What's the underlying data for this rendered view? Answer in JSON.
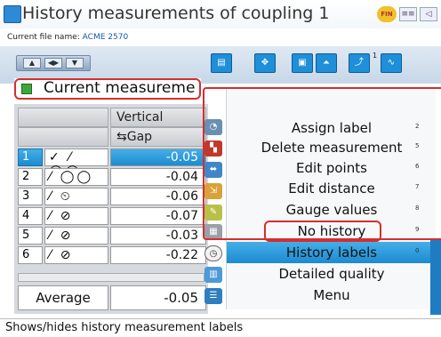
{
  "window": {
    "title": "History measurements of coupling 1",
    "status_badge": "FIN",
    "mini_icons": [
      "≡≡",
      "◁"
    ]
  },
  "file": {
    "label": "Current file name:",
    "name": "ACME 2570"
  },
  "toolbar": {
    "nav_buttons": [
      "▲",
      "◀▶",
      "▼"
    ],
    "icons": [
      {
        "name": "grid-icon",
        "glyph": "▤"
      },
      {
        "name": "compass-icon",
        "glyph": "✥"
      },
      {
        "name": "monitor-icon",
        "glyph": "▣"
      },
      {
        "name": "wave-icon",
        "glyph": "⏶"
      },
      {
        "name": "chart-icon",
        "glyph": "⤴"
      },
      {
        "name": "trend-icon",
        "glyph": "∿"
      }
    ],
    "superscript": "1"
  },
  "measurement_header": "Current measureme",
  "table": {
    "column_header": "Vertical",
    "sub_header": "Gap",
    "rows": [
      {
        "num": "1",
        "icons": "✓ ⁄ ◯◯",
        "value": "-0.05",
        "selected": true
      },
      {
        "num": "2",
        "icons": "⁄ ◯◯",
        "value": "-0.04",
        "selected": false
      },
      {
        "num": "3",
        "icons": "⁄ ⏲",
        "value": "-0.06",
        "selected": false
      },
      {
        "num": "4",
        "icons": "⁄ ⊘",
        "value": "-0.07",
        "selected": false
      },
      {
        "num": "5",
        "icons": "⁄ ⊘",
        "value": "-0.03",
        "selected": false
      },
      {
        "num": "6",
        "icons": "⁄ ⊘",
        "value": "-0.22",
        "selected": false
      }
    ],
    "average_label": "Average",
    "average_value": "-0.05"
  },
  "menu": {
    "items": [
      {
        "label": "Assign label",
        "key": "2"
      },
      {
        "label": "Delete measurement",
        "key": "5"
      },
      {
        "label": "Edit points",
        "key": "6"
      },
      {
        "label": "Edit distance",
        "key": "7"
      },
      {
        "label": "Gauge values",
        "key": "8"
      },
      {
        "label": "No history",
        "key": "9"
      },
      {
        "label": "History labels",
        "key": "0"
      },
      {
        "label": "Detailed quality",
        "key": ""
      },
      {
        "label": "Menu",
        "key": ""
      }
    ],
    "active_index": 6
  },
  "status": "Shows/hides history measurement labels",
  "colors": {
    "accent": "#1d8bd0",
    "highlight_outline": "#d62e2e",
    "checkbox": "#3ea63e"
  }
}
